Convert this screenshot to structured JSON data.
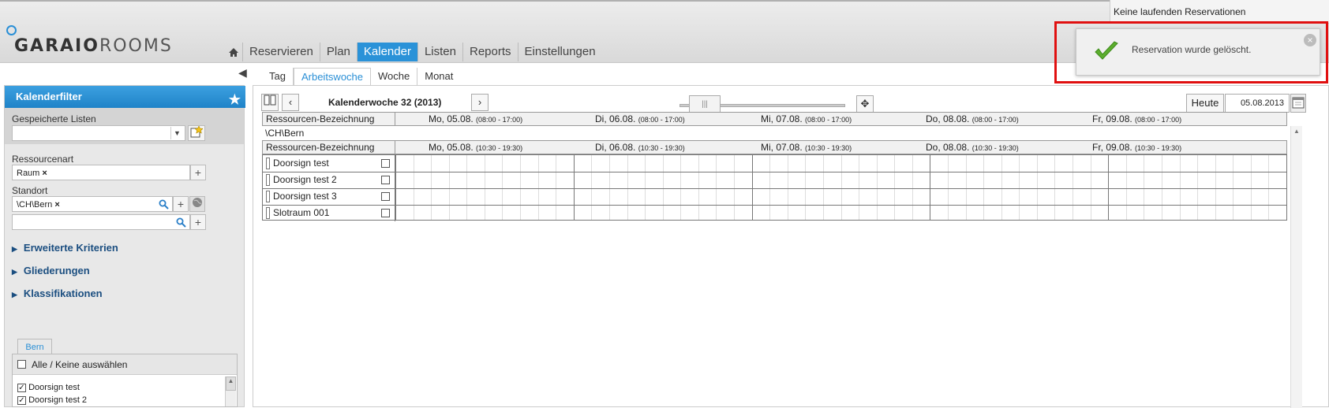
{
  "app": {
    "logo_text_bold": "GARAIO",
    "logo_text": "ROOMS"
  },
  "nav": {
    "items": [
      "Reservieren",
      "Plan",
      "Kalender",
      "Listen",
      "Reports",
      "Einstellungen"
    ],
    "active": "Kalender"
  },
  "status": {
    "running_reservations": "Keine laufenden Reservationen"
  },
  "toast": {
    "message": "Reservation wurde gelöscht.",
    "close": "×"
  },
  "sidebar": {
    "title": "Kalenderfilter",
    "saved_lists_label": "Gespeicherte Listen",
    "resource_type_label": "Ressourcenart",
    "resource_type_tag": "Raum",
    "location_label": "Standort",
    "location_tag": "\\CH\\Bern",
    "sections": [
      "Erweiterte Kriterien",
      "Gliederungen",
      "Klassifikationen"
    ],
    "tab": "Bern",
    "select_all": "Alle / Keine auswählen",
    "items": [
      "Doorsign test",
      "Doorsign test 2"
    ]
  },
  "calendar": {
    "tabs": [
      "Tag",
      "Arbeitswoche",
      "Woche",
      "Monat"
    ],
    "active_tab": "Arbeitswoche",
    "week_title": "Kalenderwoche 32 (2013)",
    "today_label": "Heute",
    "date": "05.08.2013",
    "resource_header": "Ressourcen-Bezeichnung",
    "days1": [
      {
        "label": "Mo, 05.08.",
        "time": "(08:00 - 17:00)"
      },
      {
        "label": "Di, 06.08.",
        "time": "(08:00 - 17:00)"
      },
      {
        "label": "Mi, 07.08.",
        "time": "(08:00 - 17:00)"
      },
      {
        "label": "Do, 08.08.",
        "time": "(08:00 - 17:00)"
      },
      {
        "label": "Fr, 09.08.",
        "time": "(08:00 - 17:00)"
      }
    ],
    "group": "\\CH\\Bern",
    "days2": [
      {
        "label": "Mo, 05.08.",
        "time": "(10:30 - 19:30)"
      },
      {
        "label": "Di, 06.08.",
        "time": "(10:30 - 19:30)"
      },
      {
        "label": "Mi, 07.08.",
        "time": "(10:30 - 19:30)"
      },
      {
        "label": "Do, 08.08.",
        "time": "(10:30 - 19:30)"
      },
      {
        "label": "Fr, 09.08.",
        "time": "(10:30 - 19:30)"
      }
    ],
    "resources": [
      "Doorsign test",
      "Doorsign test 2",
      "Doorsign test 3",
      "Slotraum 001"
    ]
  }
}
